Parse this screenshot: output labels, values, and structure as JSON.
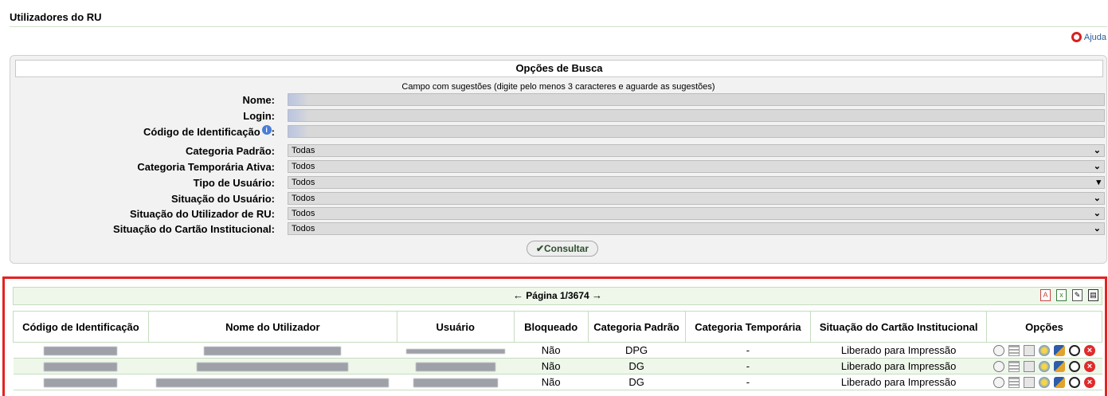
{
  "page": {
    "title": "Utilizadores do RU",
    "help_label": "Ajuda"
  },
  "search": {
    "header": "Opções de Busca",
    "hint": "Campo com sugestões (digite pelo menos 3 caracteres e aguarde as sugestões)",
    "labels": {
      "nome": "Nome:",
      "login": "Login:",
      "codigo": "Código de Identificação",
      "codigo_suffix": ":",
      "categoria_padrao": "Categoria Padrão:",
      "categoria_temporaria": "Categoria Temporária Ativa:",
      "tipo_usuario": "Tipo de Usuário:",
      "situacao_usuario": "Situação do Usuário:",
      "situacao_utilizador": "Situação do Utilizador de RU:",
      "situacao_cartao": "Situação do Cartão Institucional:"
    },
    "values": {
      "nome": "",
      "login": "",
      "codigo": "",
      "categoria_padrao": "Todas",
      "categoria_temporaria": "Todos",
      "tipo_usuario": "Todos",
      "situacao_usuario": "Todos",
      "situacao_utilizador": "Todos",
      "situacao_cartao": "Todos"
    },
    "submit_label": "Consultar",
    "submit_icon": "✔"
  },
  "results": {
    "pager": {
      "prev": "←",
      "label": "Página 1/3674",
      "next": "→"
    },
    "export_icons": [
      "pdf-icon",
      "excel-icon",
      "edit-icon",
      "print-icon"
    ],
    "columns": [
      "Código de Identificação",
      "Nome do Utilizador",
      "Usuário",
      "Bloqueado",
      "Categoria Padrão",
      "Categoria Temporária",
      "Situação do Cartão Institucional",
      "Opções"
    ],
    "rows": [
      {
        "bloqueado": "Não",
        "categoria_padrao": "DPG",
        "categoria_temporaria": "-",
        "situacao_cartao": "Liberado para Impressão"
      },
      {
        "bloqueado": "Não",
        "categoria_padrao": "DG",
        "categoria_temporaria": "-",
        "situacao_cartao": "Liberado para Impressão"
      },
      {
        "bloqueado": "Não",
        "categoria_padrao": "DG",
        "categoria_temporaria": "-",
        "situacao_cartao": "Liberado para Impressão"
      }
    ],
    "option_icons": [
      "view-icon",
      "list-icon",
      "calculator-icon",
      "card-icon",
      "users-icon",
      "block-icon",
      "delete-icon"
    ]
  },
  "colors": {
    "accent_green": "#eef7ea",
    "highlight_red": "#e52222"
  }
}
